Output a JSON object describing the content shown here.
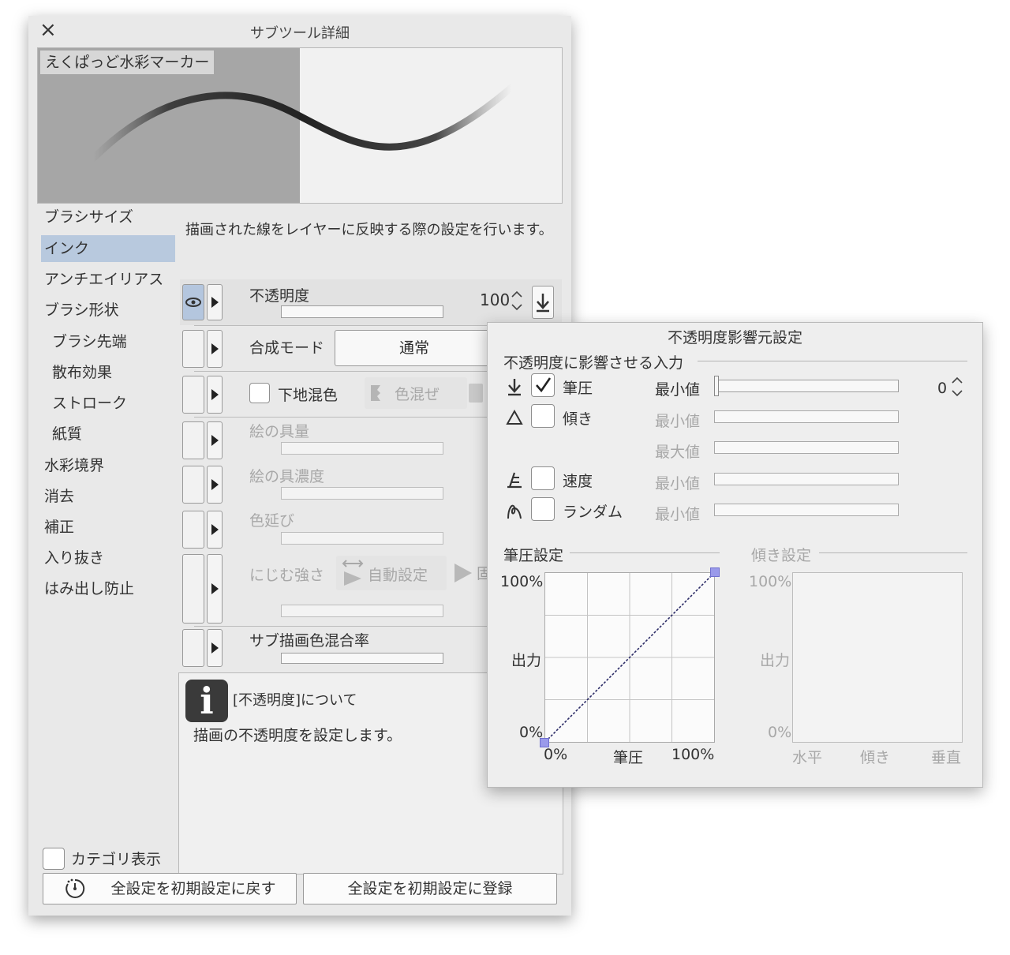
{
  "window": {
    "title": "サブツール詳細",
    "close_icon": "×",
    "brush_name": "えくぱっど水彩マーカー"
  },
  "categories": [
    {
      "label": "ブラシサイズ",
      "selected": false,
      "sub": false
    },
    {
      "label": "インク",
      "selected": true,
      "sub": false
    },
    {
      "label": "アンチエイリアス",
      "selected": false,
      "sub": false
    },
    {
      "label": "ブラシ形状",
      "selected": false,
      "sub": false
    },
    {
      "label": "ブラシ先端",
      "selected": false,
      "sub": true
    },
    {
      "label": "散布効果",
      "selected": false,
      "sub": true
    },
    {
      "label": "ストローク",
      "selected": false,
      "sub": true
    },
    {
      "label": "紙質",
      "selected": false,
      "sub": true
    },
    {
      "label": "水彩境界",
      "selected": false,
      "sub": false
    },
    {
      "label": "消去",
      "selected": false,
      "sub": false
    },
    {
      "label": "補正",
      "selected": false,
      "sub": false
    },
    {
      "label": "入り抜き",
      "selected": false,
      "sub": false
    },
    {
      "label": "はみ出し防止",
      "selected": false,
      "sub": false
    }
  ],
  "description": "描画された線をレイヤーに反映する際の設定を行います。",
  "properties": {
    "opacity": {
      "label": "不透明度",
      "value": "100",
      "level": 1.0
    },
    "blend_mode": {
      "label": "合成モード",
      "value": "通常"
    },
    "underlay_mix": {
      "label": "下地混色",
      "option_label": "色混ぜ"
    },
    "paint_amount": {
      "label": "絵の具量"
    },
    "paint_density": {
      "label": "絵の具濃度"
    },
    "color_stretch": {
      "label": "色延び"
    },
    "blur_strength": {
      "label": "にじむ強さ",
      "auto_label": "自動設定",
      "partial_label": "固"
    },
    "sub_color_mix": {
      "label": "サブ描画色混合率"
    }
  },
  "info": {
    "icon": "i",
    "title": "[不透明度]について",
    "body": "描画の不透明度を設定します。"
  },
  "footer": {
    "category_display": "カテゴリ表示",
    "reset_button": "全設定を初期設定に戻す",
    "register_button": "全設定を初期設定に登録"
  },
  "popup": {
    "title": "不透明度影響元設定",
    "section_input": "不透明度に影響させる入力",
    "inputs": [
      {
        "label": "筆圧",
        "checked": true,
        "icon": "pen-pressure-icon",
        "min_label": "最小値",
        "value": "0"
      },
      {
        "label": "傾き",
        "checked": false,
        "icon": "tilt-icon",
        "min_label": "最小値",
        "max_label": "最大値"
      },
      {
        "label": "速度",
        "checked": false,
        "icon": "speed-icon",
        "min_label": "最小値"
      },
      {
        "label": "ランダム",
        "checked": false,
        "icon": "random-icon",
        "min_label": "最小値"
      }
    ],
    "pressure_graph": {
      "title": "筆圧設定",
      "y_top": "100%",
      "y_mid": "出力",
      "y_bottom": "0%",
      "x_left": "0%",
      "x_mid": "筆圧",
      "x_right": "100%",
      "curve": [
        [
          0,
          0
        ],
        [
          100,
          100
        ]
      ]
    },
    "tilt_graph": {
      "title": "傾き設定",
      "y_top": "100%",
      "y_mid": "出力",
      "y_bottom": "0%",
      "x_left": "水平",
      "x_mid": "傾き",
      "x_right": "垂直"
    }
  }
}
